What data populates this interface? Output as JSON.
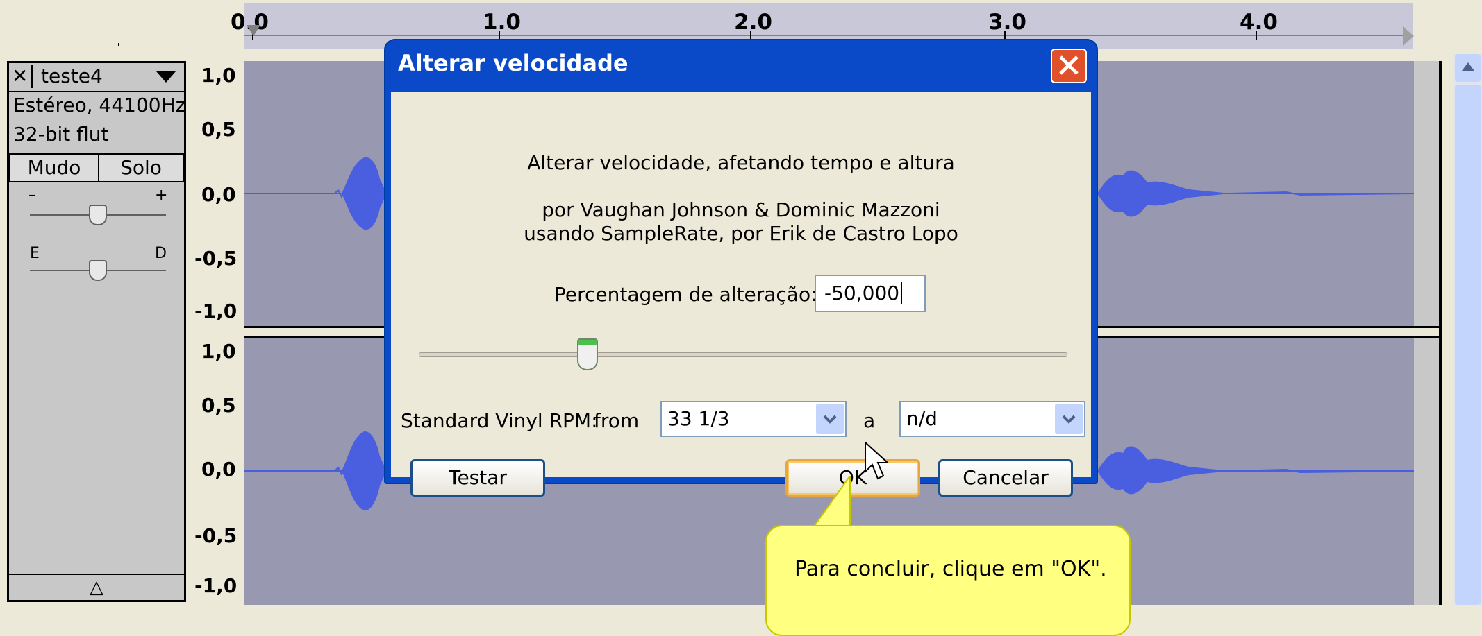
{
  "ruler": {
    "labels": [
      "0.0",
      "1.0",
      "2.0",
      "3.0",
      "4.0"
    ]
  },
  "track": {
    "name": "teste4",
    "format": "Estéreo, 44100Hz",
    "bitdepth": "32-bit flut",
    "mute_label": "Mudo",
    "solo_label": "Solo",
    "gain_minus": "–",
    "gain_plus": "+",
    "pan_left": "E",
    "pan_right": "D",
    "collapse_icon": "△",
    "close_icon": "✕"
  },
  "scale": {
    "top": [
      "1,0",
      "0,5",
      "0,0",
      "-0,5",
      "-1,0"
    ],
    "bottom": [
      "1,0",
      "0,5",
      "0,0",
      "-0,5",
      "-1,0"
    ]
  },
  "dialog": {
    "title": "Alterar velocidade",
    "description": "Alterar velocidade, afetando tempo e altura",
    "credits_line1": "por Vaughan Johnson & Dominic Mazzoni",
    "credits_line2": "usando SampleRate, por Erik de Castro Lopo",
    "percent_label": "Percentagem de alteração:",
    "percent_value": "-50,000",
    "slider_value_percent": -50,
    "rpm_label": "Standard Vinyl RPM:",
    "from_label": "from",
    "from_value": "33 1/3",
    "to_label": "a",
    "to_value": "n/d",
    "test_button": "Testar",
    "ok_button": "OK",
    "cancel_button": "Cancelar"
  },
  "tooltip": {
    "text": "Para concluir, clique em \"OK\"."
  },
  "colors": {
    "waveform": "#4a5fe0",
    "track_bg": "#9898b0",
    "title_bar": "#0a4ac8",
    "tooltip_bg": "#ffff80"
  }
}
